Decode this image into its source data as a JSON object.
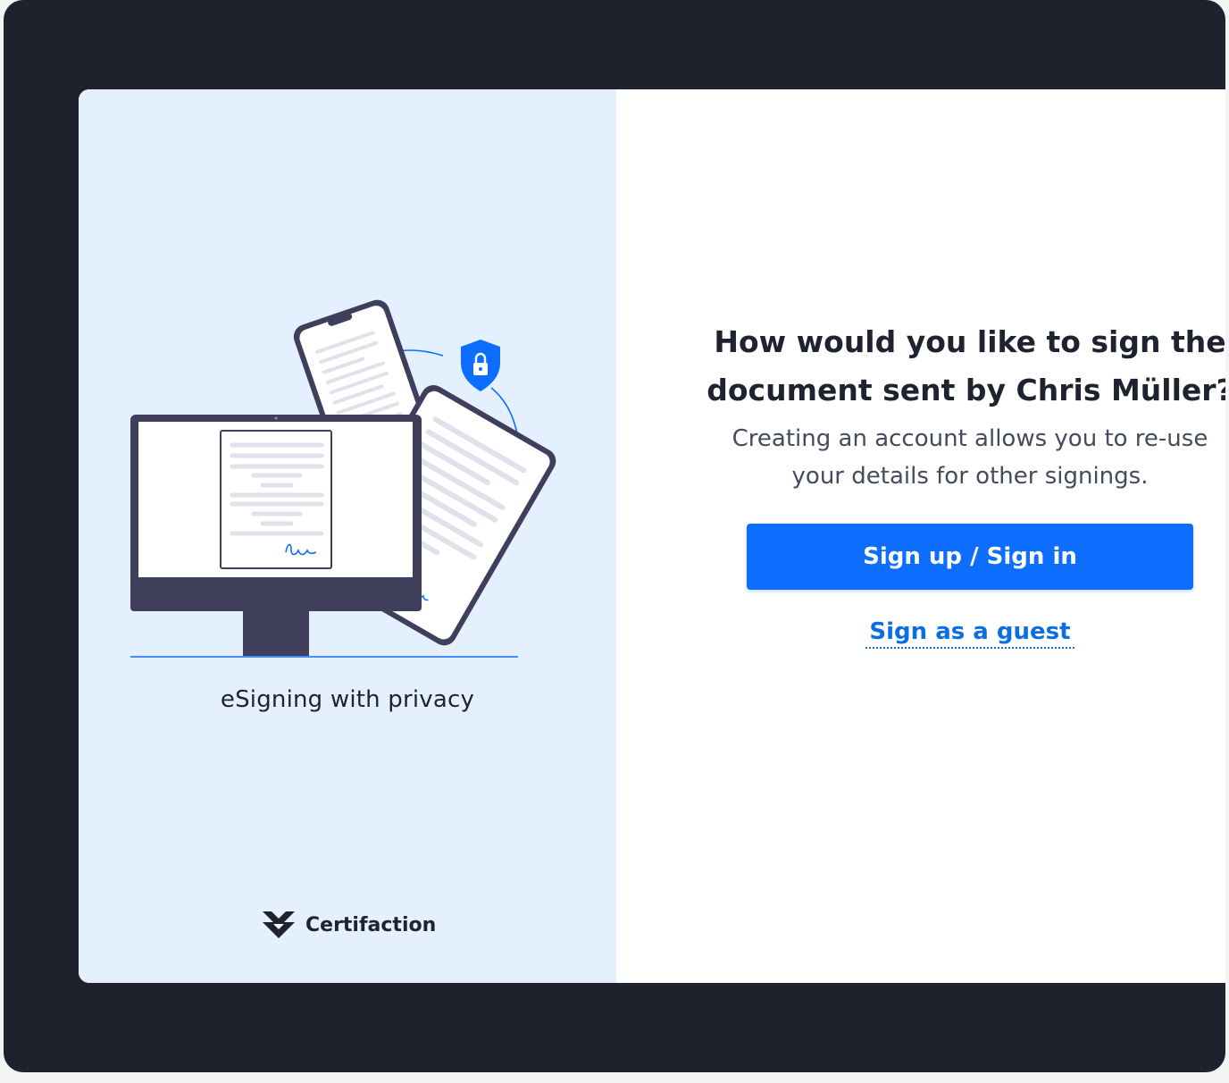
{
  "illustration": {
    "tagline": "eSigning with privacy",
    "icons": [
      "desktop-monitor",
      "smartphone",
      "tablet",
      "shield-lock-icon"
    ]
  },
  "brand": {
    "name": "Certifaction",
    "logo_icon": "certifaction-logo-icon"
  },
  "signin": {
    "question": "How would you like to sign the document sent by Chris Müller?",
    "subtitle": "Creating an account allows you to re-use your details for other signings.",
    "primary_button": "Sign up / Sign in",
    "guest_link": "Sign as a guest"
  },
  "colors": {
    "frame": "#1f222d",
    "left_panel": "#e4f0fd",
    "accent": "#0d6efd",
    "text": "#1f2330",
    "muted_text": "#454b5c"
  }
}
